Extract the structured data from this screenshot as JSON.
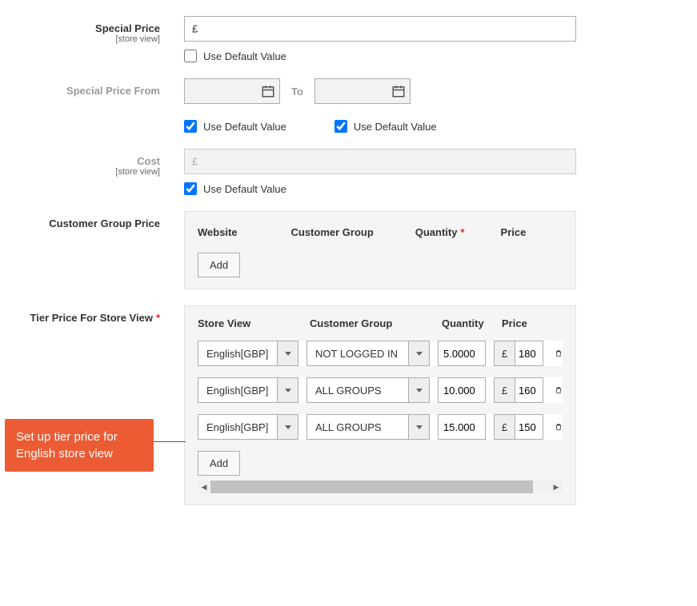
{
  "currency_symbol": "£",
  "fields": {
    "special_price": {
      "label": "Special Price",
      "scope": "[store view]",
      "udv": "Use Default Value",
      "udv_checked": false
    },
    "special_from": {
      "label": "Special Price From",
      "to": "To",
      "udv": "Use Default Value"
    },
    "cost": {
      "label": "Cost",
      "scope": "[store view]",
      "udv": "Use Default Value"
    },
    "cgp": {
      "label": "Customer Group Price",
      "cols": {
        "website": "Website",
        "group": "Customer Group",
        "qty": "Quantity",
        "price": "Price"
      },
      "add": "Add"
    },
    "tier": {
      "label": "Tier Price For Store View",
      "cols": {
        "store": "Store View",
        "group": "Customer Group",
        "qty": "Quantity",
        "price": "Price"
      },
      "add": "Add"
    }
  },
  "tier_rows": [
    {
      "store": "English[GBP]",
      "group": "NOT LOGGED IN",
      "qty": "5.0000",
      "price": "180"
    },
    {
      "store": "English[GBP]",
      "group": "ALL GROUPS",
      "qty": "10.000",
      "price": "160"
    },
    {
      "store": "English[GBP]",
      "group": "ALL GROUPS",
      "qty": "15.000",
      "price": "150"
    }
  ],
  "callout": {
    "line1": "Set up tier price for",
    "line2": "English store view"
  }
}
